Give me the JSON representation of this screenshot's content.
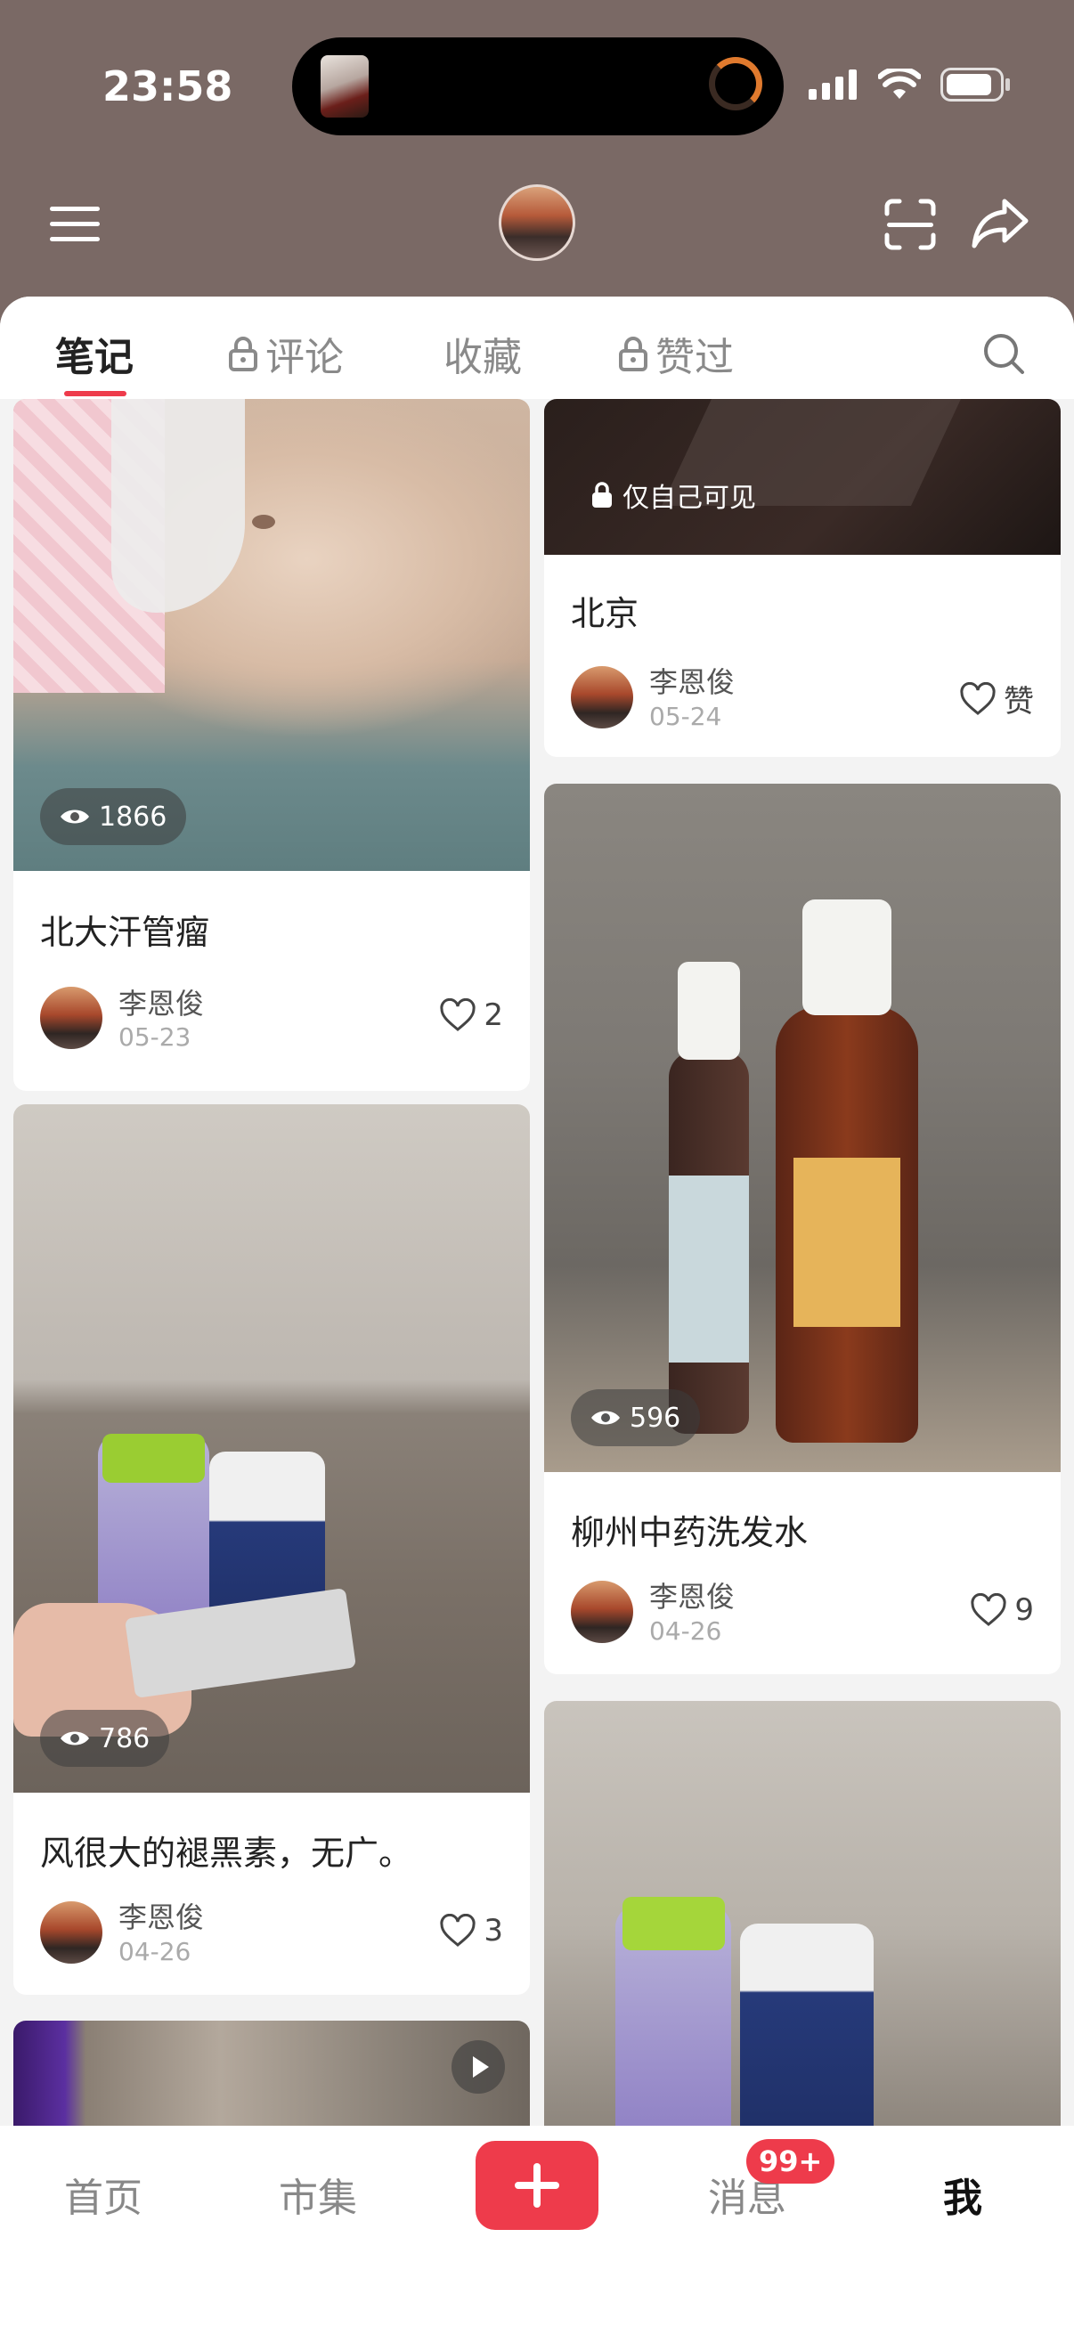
{
  "status": {
    "time": "23:58"
  },
  "tabs": [
    {
      "label": "笔记",
      "locked": false,
      "active": true
    },
    {
      "label": "评论",
      "locked": true,
      "active": false
    },
    {
      "label": "收藏",
      "locked": false,
      "active": false
    },
    {
      "label": "赞过",
      "locked": true,
      "active": false
    }
  ],
  "notes": [
    {
      "title": "北大汗管瘤",
      "views": "1866",
      "author": "李恩俊",
      "date": "05-23",
      "likes": "2"
    },
    {
      "title": "北京",
      "badge": "仅自己可见",
      "author": "李恩俊",
      "date": "05-24",
      "likes": "赞"
    },
    {
      "title": "柳州中药洗发水",
      "views": "596",
      "author": "李恩俊",
      "date": "04-26",
      "likes": "9"
    },
    {
      "title": "风很大的褪黑素，无广。",
      "views": "786",
      "author": "李恩俊",
      "date": "04-26",
      "likes": "3"
    }
  ],
  "nav": {
    "home": "首页",
    "market": "市集",
    "messages": "消息",
    "messages_badge": "99+",
    "me": "我"
  },
  "colors": {
    "accent": "#ee3b4b",
    "header_bg": "#7a6965"
  }
}
